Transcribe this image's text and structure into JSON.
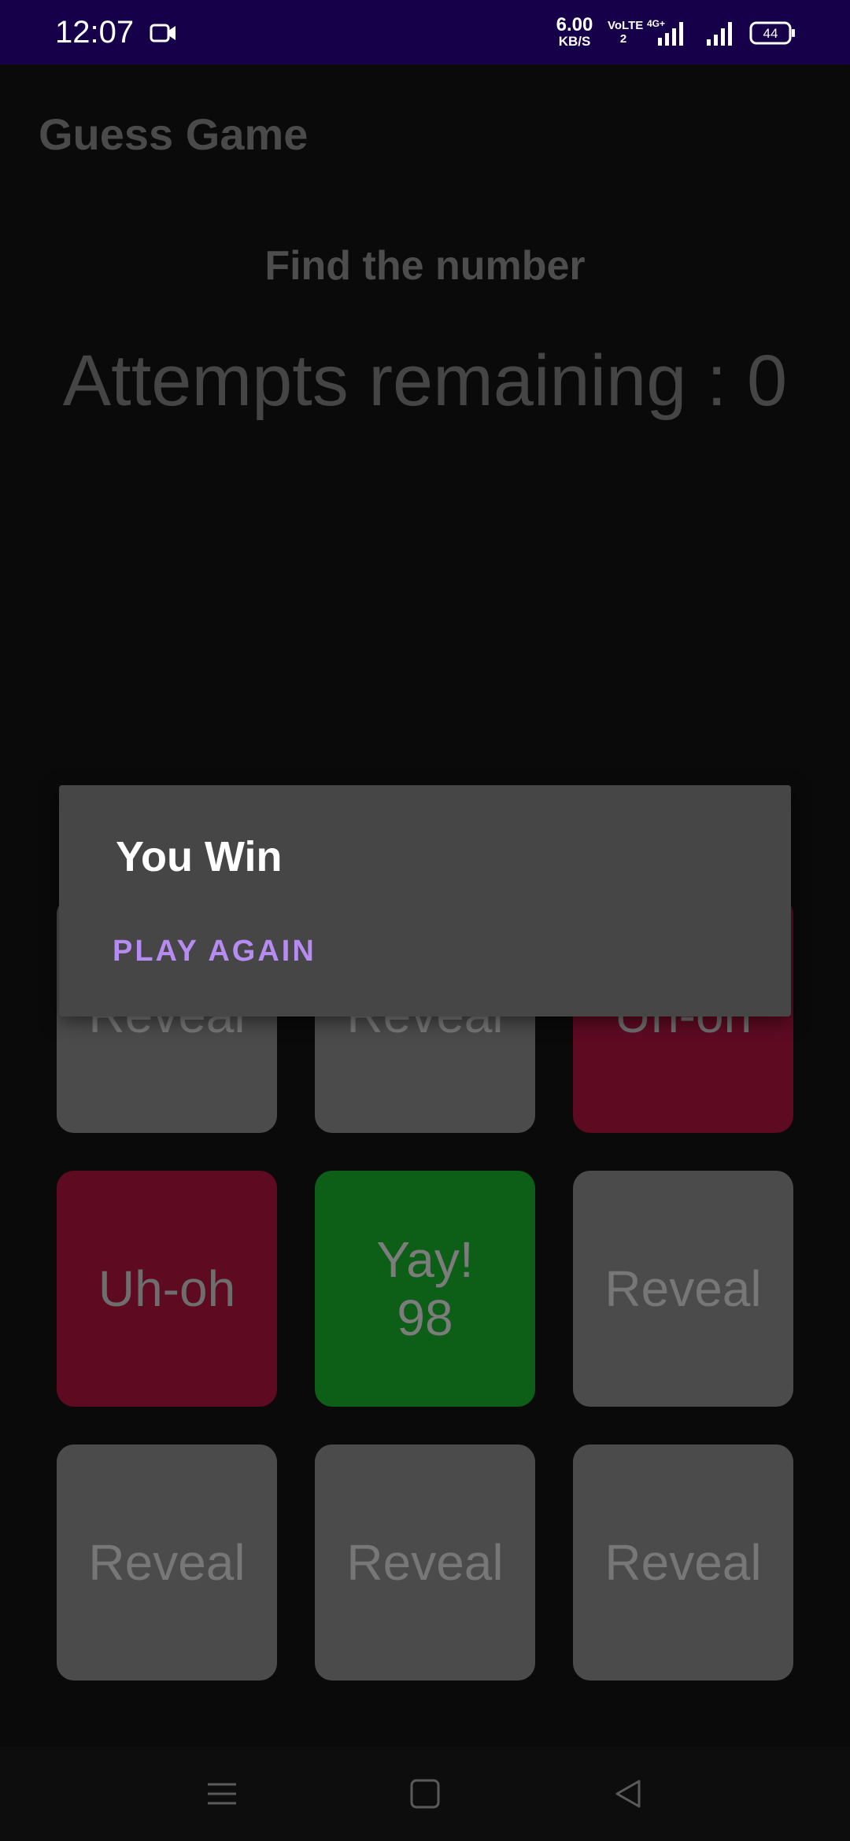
{
  "status_bar": {
    "time": "12:07",
    "speed_value": "6.00",
    "speed_unit": "KB/S",
    "volte": "VoLTE 2",
    "battery": "44",
    "icons": [
      "camera-icon",
      "signal-icon",
      "battery-icon"
    ]
  },
  "app": {
    "title": "Guess Game",
    "subtitle": "Find the number",
    "attempts": "Attempts remaining : 0"
  },
  "grid": [
    {
      "label": "Reveal",
      "state": "hidden"
    },
    {
      "label": "Reveal",
      "state": "hidden"
    },
    {
      "label": "Uh-oh",
      "state": "wrong"
    },
    {
      "label": "Uh-oh",
      "state": "wrong"
    },
    {
      "label": "Yay!\n98",
      "state": "correct"
    },
    {
      "label": "Reveal",
      "state": "hidden"
    },
    {
      "label": "Reveal",
      "state": "hidden"
    },
    {
      "label": "Reveal",
      "state": "hidden"
    },
    {
      "label": "Reveal",
      "state": "hidden"
    }
  ],
  "dialog": {
    "title": "You Win",
    "action_label": "PLAY AGAIN"
  },
  "nav_bar": {
    "icons": [
      "menu-icon",
      "home-icon",
      "back-icon"
    ]
  },
  "colors": {
    "status_bar": "#16004a",
    "accent": "#b68cf2",
    "wrong": "#5e0b22",
    "correct": "#0d5e17",
    "hidden": "#4b4b4b"
  }
}
